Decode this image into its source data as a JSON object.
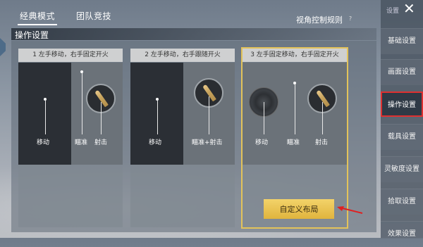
{
  "top_tabs": [
    "经典模式",
    "团队竞技"
  ],
  "view_rules": "视角控制规则",
  "help_symbol": "?",
  "section_title": "操作设置",
  "cards": [
    {
      "header": "1  左手移动，右手固定开火",
      "labels": [
        "移动",
        "瞄准",
        "射击"
      ]
    },
    {
      "header": "2  左手移动，右手跟随开火",
      "labels": [
        "移动",
        "瞄准+射击"
      ]
    },
    {
      "header": "3  左手固定移动，右手固定开火",
      "labels": [
        "移动",
        "瞄准",
        "射击"
      ]
    }
  ],
  "custom_button": "自定义布局",
  "sidebar": {
    "title": "设置",
    "close": "✕",
    "items": [
      "基础设置",
      "画面设置",
      "操作设置",
      "载具设置",
      "灵敏度设置",
      "拾取设置",
      "效果设置"
    ],
    "active_index": 2
  },
  "colors": {
    "accent_gold": "#e3c35a",
    "highlight_red": "#e03030"
  }
}
